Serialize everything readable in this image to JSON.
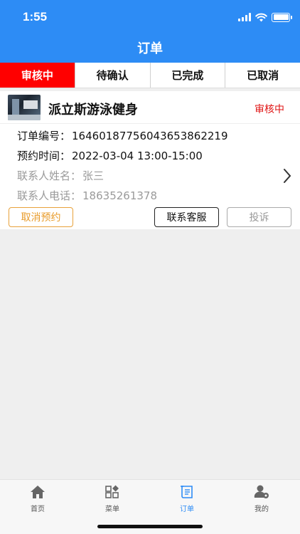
{
  "status_bar": {
    "time": "1:55"
  },
  "header": {
    "title": "订单"
  },
  "tabs": [
    {
      "label": "审核中",
      "active": true
    },
    {
      "label": "待确认",
      "active": false
    },
    {
      "label": "已完成",
      "active": false
    },
    {
      "label": "已取消",
      "active": false
    }
  ],
  "order": {
    "shop_name": "派立斯游泳健身",
    "status": "审核中",
    "number_label": "订单编号：",
    "number": "1646018775604365386221​9",
    "time_label": "预约时间：",
    "time": "2022-03-04 13:00-15:00",
    "contact_name_label": "联系人姓名：",
    "contact_name": "张三",
    "contact_phone_label": "联系人电话：",
    "contact_phone": "18635261378",
    "buttons": {
      "cancel": "取消预约",
      "service": "联系客服",
      "complain": "投诉"
    }
  },
  "tabbar": [
    {
      "label": "首页",
      "icon": "home-icon",
      "active": false
    },
    {
      "label": "菜单",
      "icon": "menu-grid-icon",
      "active": false
    },
    {
      "label": "订单",
      "icon": "order-scroll-icon",
      "active": true
    },
    {
      "label": "我的",
      "icon": "user-settings-icon",
      "active": false
    }
  ],
  "colors": {
    "primary": "#2d8cf5",
    "active_tab": "#ff0000",
    "status_red": "#e01515",
    "cancel_orange": "#e89b2a"
  }
}
